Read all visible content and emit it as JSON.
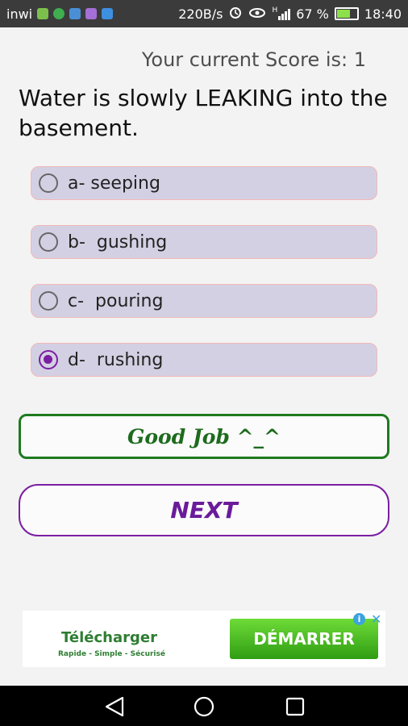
{
  "status_bar": {
    "carrier": "inwi",
    "speed": "220B/s",
    "signal_label": "H",
    "battery_pct": "67 %",
    "time": "18:40",
    "icons": [
      "app-icon-1",
      "app-icon-2",
      "app-icon-3",
      "app-icon-4",
      "app-icon-5",
      "alarm-icon",
      "eye-icon",
      "signal-icon",
      "battery-icon"
    ]
  },
  "score": {
    "label": "Your current Score is: 1"
  },
  "question": {
    "text": "Water is slowly LEAKING into the basement."
  },
  "options": [
    {
      "label": "a- seeping",
      "selected": false
    },
    {
      "label": "b-  gushing",
      "selected": false
    },
    {
      "label": "c-  pouring",
      "selected": false
    },
    {
      "label": "d-  rushing",
      "selected": true
    }
  ],
  "feedback": {
    "text": "Good Job ^_^"
  },
  "next_button": {
    "label": "NEXT"
  },
  "ad": {
    "title": "Télécharger",
    "subtitle": "Rapide - Simple - Sécurisé",
    "cta": "DÉMARRER",
    "info_icon": "i",
    "close_icon": "✕"
  },
  "colors": {
    "accent": "#7b1fa2",
    "success": "#1f7a1f",
    "option_bg": "#d4d0e3",
    "ad_green": "#2e7d32"
  }
}
